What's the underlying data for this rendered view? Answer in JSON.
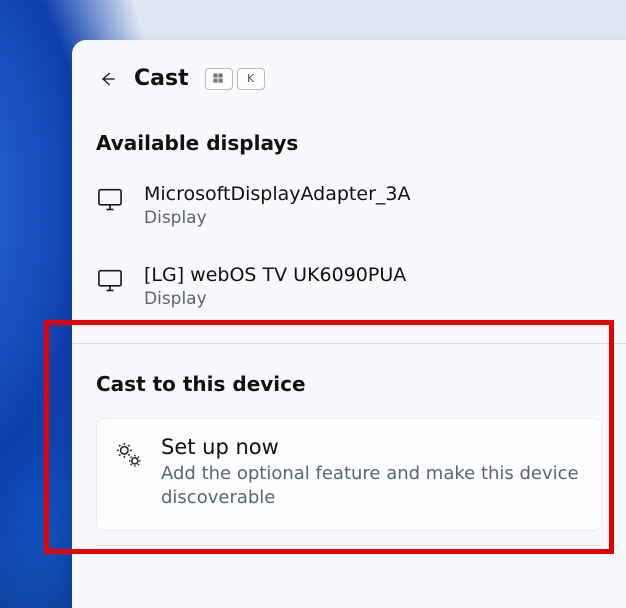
{
  "header": {
    "title": "Cast",
    "shortcut_key": "K"
  },
  "sections": {
    "available_title": "Available displays",
    "cast_to_title": "Cast to this device"
  },
  "devices": [
    {
      "name": "MicrosoftDisplayAdapter_3A",
      "subtitle": "Display"
    },
    {
      "name": "[LG] webOS TV UK6090PUA",
      "subtitle": "Display"
    }
  ],
  "setup": {
    "title": "Set up now",
    "subtitle": "Add the optional feature and make this device discoverable"
  }
}
